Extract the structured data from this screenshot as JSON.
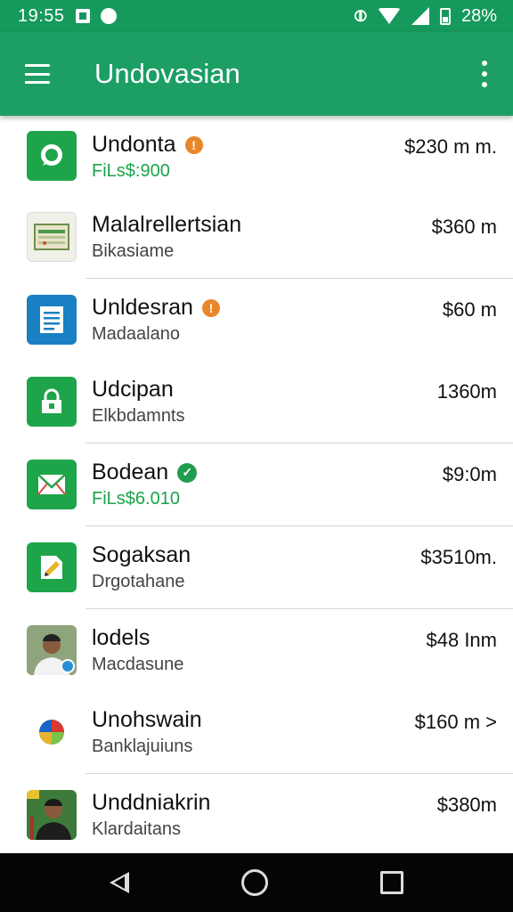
{
  "status_bar": {
    "time": "19:55",
    "battery": "28%"
  },
  "app_bar": {
    "title": "Undovasian"
  },
  "colors": {
    "primary": "#1c9e64",
    "status": "#16995c",
    "badge_orange": "#e8862a",
    "badge_green": "#1f9c4f",
    "subtitle_green": "#1aa34a"
  },
  "items": [
    {
      "title": "Undonta",
      "subtitle": "FiLs$:900",
      "amount": "$230 m m.",
      "icon": "chat-icon",
      "badge": "!"
    },
    {
      "title": "Malalrellertsian",
      "subtitle": "Bikasiame",
      "amount": "$360 m",
      "icon": "spreadsheet-icon"
    },
    {
      "title": "Unldesran",
      "subtitle": "Madaalano",
      "amount": "$60 m",
      "icon": "document-icon",
      "badge": "!"
    },
    {
      "title": "Udcipan",
      "subtitle": "Elkbdamnts",
      "amount": "1360m",
      "icon": "lock-icon"
    },
    {
      "title": "Bodean",
      "subtitle": "FiLs$6.010",
      "amount": "$9:0m",
      "icon": "mail-icon",
      "badge": "✓"
    },
    {
      "title": "Sogaksan",
      "subtitle": "Drgotahane",
      "amount": "$3510m.",
      "icon": "edit-icon"
    },
    {
      "title": "lodels",
      "subtitle": "Macdasune",
      "amount": "$48 Inm",
      "icon": "avatar-man-icon"
    },
    {
      "title": "Unohswain",
      "subtitle": "Banklajuiuns",
      "amount": "$160 m >",
      "icon": "pie-logo-icon"
    },
    {
      "title": "Unddniakrin",
      "subtitle": "Klardaitans",
      "amount": "$380m",
      "icon": "avatar-man-2-icon"
    }
  ]
}
